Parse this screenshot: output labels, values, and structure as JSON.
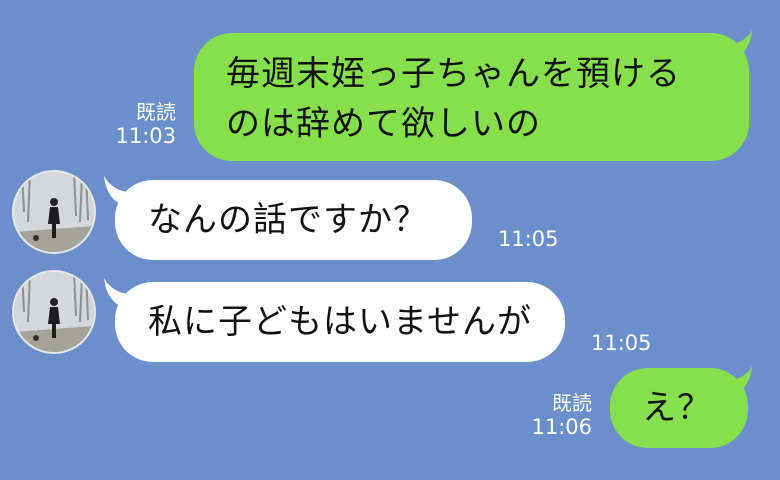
{
  "colors": {
    "background": "#6a8fcb",
    "outgoing_bubble": "#86e04b",
    "incoming_bubble": "#ffffff"
  },
  "messages": [
    {
      "direction": "outgoing",
      "lines": [
        "毎週末姪っ子ちゃんを預ける",
        "のは辞めて欲しいの"
      ],
      "read_label": "既読",
      "time": "11:03"
    },
    {
      "direction": "incoming",
      "avatar": "contact-avatar-walking-person",
      "text": "なんの話ですか？",
      "time": "11:05"
    },
    {
      "direction": "incoming",
      "avatar": "contact-avatar-walking-person",
      "text": "私に子どもはいませんが",
      "time": "11:05"
    },
    {
      "direction": "outgoing",
      "text": "え？",
      "read_label": "既読",
      "time": "11:06"
    }
  ]
}
